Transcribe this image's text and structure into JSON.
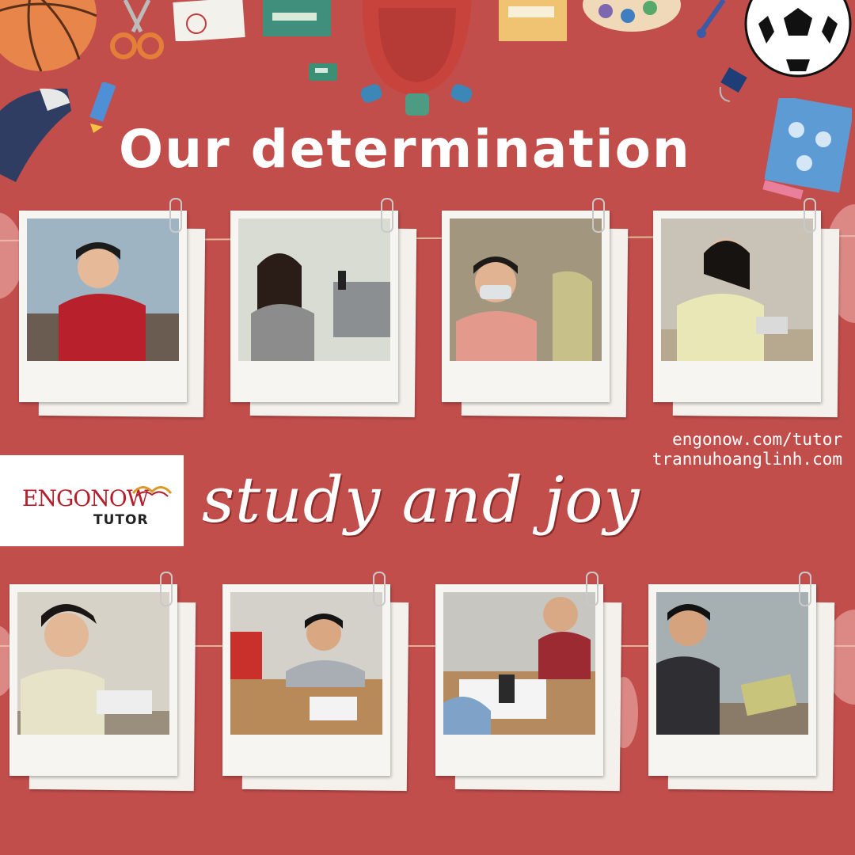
{
  "title": "Our determination",
  "subtitle": "study and joy",
  "links": [
    "engonow.com/tutor",
    "trannuhoanglinh.com"
  ],
  "logo": {
    "main": "ENGONOW",
    "sub": "TUTOR"
  },
  "colors": {
    "background": "#c24e4c",
    "polaroid": "#f7f5f1",
    "logo_red": "#b31f2a",
    "text": "#ffffff"
  },
  "photos_top": [
    {
      "scene": "student-calculator",
      "bg": "#9fb4c2",
      "shirt": "#b8202c",
      "skin": "#e6b999"
    },
    {
      "scene": "student-phone",
      "bg": "#d9dcd2",
      "shirt": "#8c8c8c",
      "skin": "#e8c0a2"
    },
    {
      "scene": "student-mask",
      "bg": "#a2967f",
      "shirt": "#e39a8d",
      "skin": "#e2b393"
    },
    {
      "scene": "student-writing",
      "bg": "#c9c2b6",
      "shirt": "#e9e7b5",
      "skin": "#e7bf9f"
    }
  ],
  "photos_bottom": [
    {
      "scene": "student-glasses",
      "bg": "#d6d2c8",
      "shirt": "#e7e3c8",
      "skin": "#e3b897"
    },
    {
      "scene": "students-desk",
      "bg": "#d4d1cb",
      "shirt": "#a9aeb5",
      "skin": "#d9a883"
    },
    {
      "scene": "students-calculators",
      "bg": "#c8c6c1",
      "shirt": "#9c2a32",
      "skin": "#d8a984"
    },
    {
      "scene": "student-laptop",
      "bg": "#a6b0b3",
      "shirt": "#2f2f33",
      "skin": "#d6a37f"
    }
  ]
}
